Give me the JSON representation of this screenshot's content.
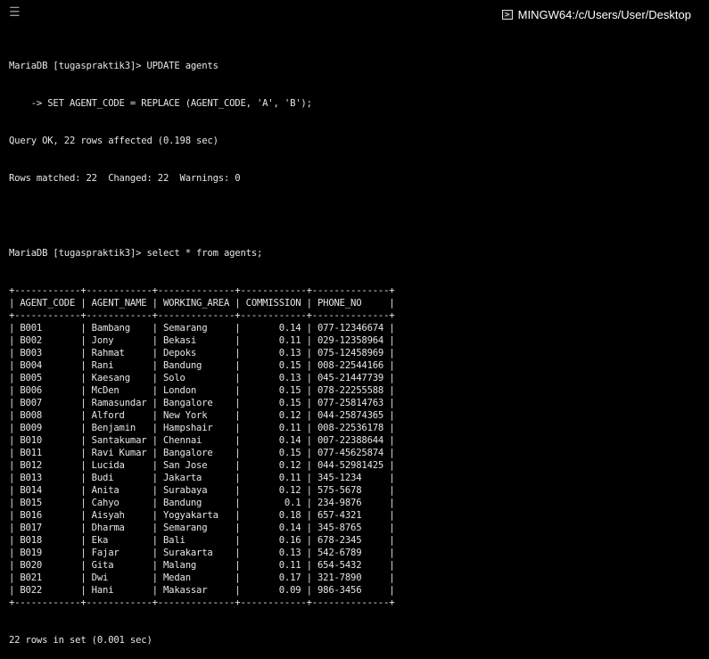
{
  "window": {
    "title": "MINGW64:/c/Users/User/Desktop",
    "menu_icon": "hamburger-menu-icon",
    "terminal_icon": "terminal-icon"
  },
  "terminal": {
    "prompt1": "MariaDB [tugaspraktik3]> UPDATE agents",
    "prompt1_cont": "    -> SET AGENT_CODE = REPLACE (AGENT_CODE, 'A', 'B');",
    "query_ok": "Query OK, 22 rows affected (0.198 sec)",
    "rows_matched": "Rows matched: 22  Changed: 22  Warnings: 0",
    "prompt2": "MariaDB [tugaspraktik3]> select * from agents;",
    "footer": "22 rows in set (0.001 sec)",
    "columns": [
      "AGENT_CODE",
      "AGENT_NAME",
      "WORKING_AREA",
      "COMMISSION",
      "PHONE_NO"
    ],
    "rows": [
      [
        "B001",
        "Bambang",
        "Semarang",
        "0.14",
        "077-12346674"
      ],
      [
        "B002",
        "Jony",
        "Bekasi",
        "0.11",
        "029-12358964"
      ],
      [
        "B003",
        "Rahmat",
        "Depoks",
        "0.13",
        "075-12458969"
      ],
      [
        "B004",
        "Rani",
        "Bandung",
        "0.15",
        "008-22544166"
      ],
      [
        "B005",
        "Kaesang",
        "Solo",
        "0.13",
        "045-21447739"
      ],
      [
        "B006",
        "McDen",
        "London",
        "0.15",
        "078-22255588"
      ],
      [
        "B007",
        "Ramasundar",
        "Bangalore",
        "0.15",
        "077-25814763"
      ],
      [
        "B008",
        "Alford",
        "New York",
        "0.12",
        "044-25874365"
      ],
      [
        "B009",
        "Benjamin",
        "Hampshair",
        "0.11",
        "008-22536178"
      ],
      [
        "B010",
        "Santakumar",
        "Chennai",
        "0.14",
        "007-22388644"
      ],
      [
        "B011",
        "Ravi Kumar",
        "Bangalore",
        "0.15",
        "077-45625874"
      ],
      [
        "B012",
        "Lucida",
        "San Jose",
        "0.12",
        "044-52981425"
      ],
      [
        "B013",
        "Budi",
        "Jakarta",
        "0.11",
        "345-1234"
      ],
      [
        "B014",
        "Anita",
        "Surabaya",
        "0.12",
        "575-5678"
      ],
      [
        "B015",
        "Cahyo",
        "Bandung",
        "0.1",
        "234-9876"
      ],
      [
        "B016",
        "Aisyah",
        "Yogyakarta",
        "0.18",
        "657-4321"
      ],
      [
        "B017",
        "Dharma",
        "Semarang",
        "0.14",
        "345-8765"
      ],
      [
        "B018",
        "Eka",
        "Bali",
        "0.16",
        "678-2345"
      ],
      [
        "B019",
        "Fajar",
        "Surakarta",
        "0.13",
        "542-6789"
      ],
      [
        "B020",
        "Gita",
        "Malang",
        "0.11",
        "654-5432"
      ],
      [
        "B021",
        "Dwi",
        "Medan",
        "0.17",
        "321-7890"
      ],
      [
        "B022",
        "Hani",
        "Makassar",
        "0.09",
        "986-3456"
      ]
    ]
  }
}
